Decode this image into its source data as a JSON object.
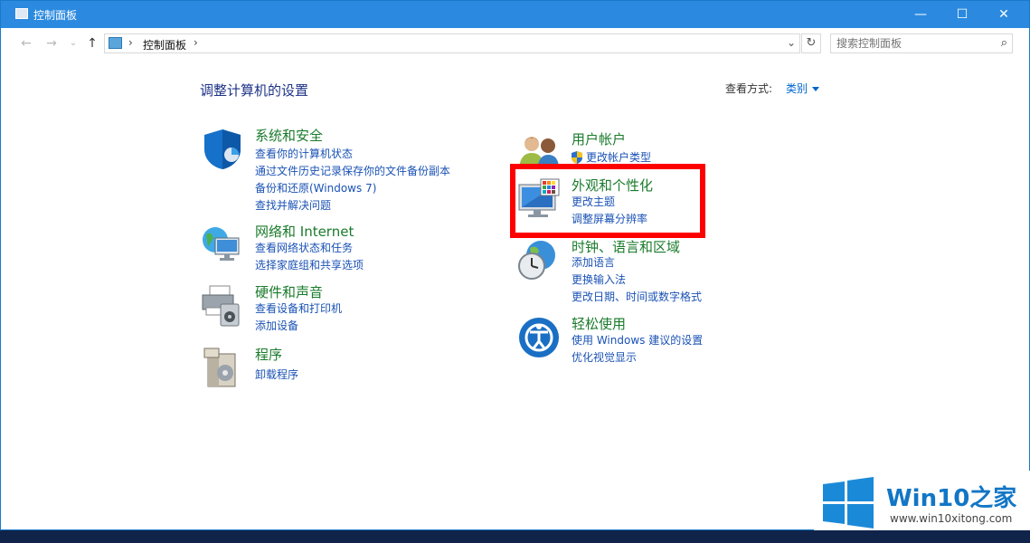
{
  "window": {
    "title": "控制面板",
    "minimize": "—",
    "maximize": "☐",
    "close": "✕"
  },
  "nav": {
    "back": "←",
    "forward": "→",
    "recent": "⌄",
    "up": "↑"
  },
  "address": {
    "separator": "›",
    "crumb": "控制面板",
    "end_separator": "›",
    "dropdown": "⌄"
  },
  "refresh": "↻",
  "search": {
    "placeholder": "搜索控制面板",
    "icon": "⌕"
  },
  "heading": "调整计算机的设置",
  "view_by": {
    "label": "查看方式:",
    "value": "类别"
  },
  "categories_left": [
    {
      "title": "系统和安全",
      "links": [
        "查看你的计算机状态",
        "通过文件历史记录保存你的文件备份副本",
        "备份和还原(Windows 7)",
        "查找并解决问题"
      ]
    },
    {
      "title": "网络和 Internet",
      "links": [
        "查看网络状态和任务",
        "选择家庭组和共享选项"
      ]
    },
    {
      "title": "硬件和声音",
      "links": [
        "查看设备和打印机",
        "添加设备"
      ]
    },
    {
      "title": "程序",
      "links": [
        "卸载程序"
      ]
    }
  ],
  "categories_right": [
    {
      "title": "用户帐户",
      "links": [
        "更改帐户类型"
      ]
    },
    {
      "title": "外观和个性化",
      "links": [
        "更改主题",
        "调整屏幕分辨率"
      ]
    },
    {
      "title": "时钟、语言和区域",
      "links": [
        "添加语言",
        "更换输入法",
        "更改日期、时间或数字格式"
      ]
    },
    {
      "title": "轻松使用",
      "links": [
        "使用 Windows 建议的设置",
        "优化视觉显示"
      ]
    }
  ],
  "watermark": {
    "brand": "Win10之家",
    "url": "www.win10xitong.com"
  },
  "colors": {
    "titlebar": "#2b8ae0",
    "category_title": "#1a7b2b",
    "link": "#1a52b5",
    "highlight": "#ff0000"
  }
}
